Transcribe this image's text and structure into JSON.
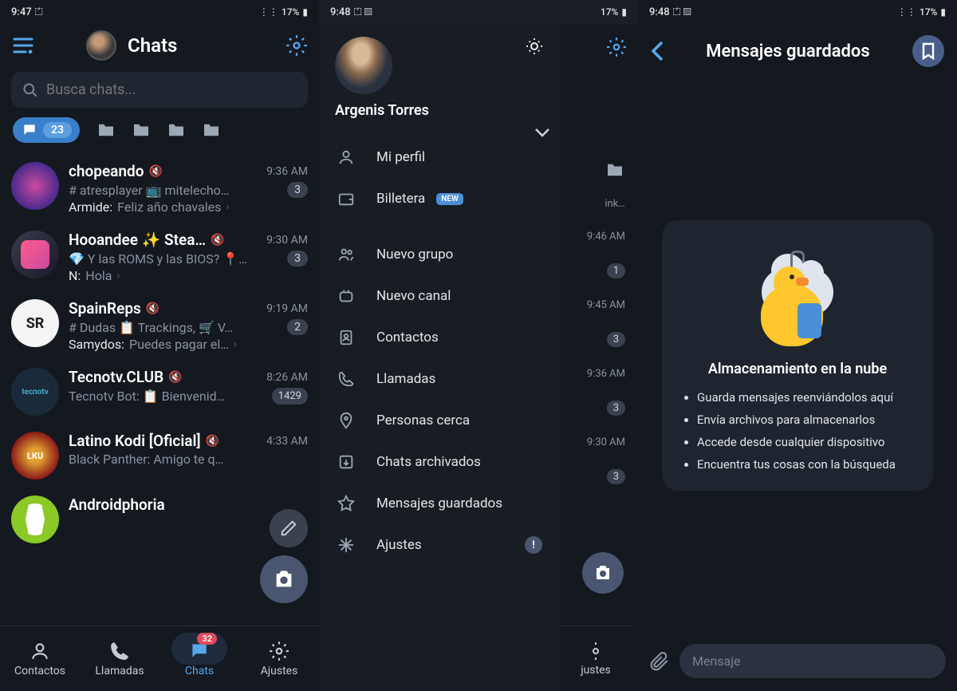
{
  "status": {
    "time1": "9:47",
    "time2": "9:48",
    "time3": "9:48",
    "battery": "17%"
  },
  "screen1": {
    "title": "Chats",
    "search_placeholder": "Busca chats...",
    "unread_pill": "23",
    "chats": [
      {
        "name": "chopeando",
        "time": "9:36 AM",
        "line1": "# atresplayer 📺 mitelecho…",
        "badge": "3",
        "sender": "Armide:",
        "msg": "Feliz año chavales"
      },
      {
        "name": "Hooandee ✨ Stea…",
        "time": "9:30 AM",
        "line1": "💎 Y las ROMS y las BIOS? 📍…",
        "badge": "3",
        "sender": "N:",
        "msg": "Hola"
      },
      {
        "name": "SpainReps",
        "time": "9:19 AM",
        "line1": "# Dudas 📋 Trackings, 🛒 V…",
        "badge": "2",
        "sender": "Samydos:",
        "msg": "Puedes pagar el…"
      },
      {
        "name": "Tecnotv.CLUB",
        "time": "8:26 AM",
        "line1": "Tecnotv Bot: 📋 Bienvenid…",
        "badge": "1429"
      },
      {
        "name": "Latino Kodi [Oficial]",
        "time": "4:33 AM",
        "line1": "Black Panther: Amigo te q…"
      },
      {
        "name": "Androidphoria",
        "time": ""
      }
    ],
    "nav": {
      "contactos": "Contactos",
      "llamadas": "Llamadas",
      "chats": "Chats",
      "ajustes": "Ajustes",
      "badge": "32"
    }
  },
  "screen2": {
    "name": "Argenis Torres",
    "items": {
      "perfil": "Mi perfil",
      "billetera": "Billetera",
      "new": "NEW",
      "grupo": "Nuevo grupo",
      "canal": "Nuevo canal",
      "contactos": "Contactos",
      "llamadas": "Llamadas",
      "cerca": "Personas cerca",
      "archivados": "Chats archivados",
      "guardados": "Mensajes guardados",
      "ajustes": "Ajustes"
    },
    "peek": {
      "t1": "ink…",
      "t2": "9:46 AM",
      "b2": "1",
      "t3": "9:45 AM",
      "b3": "3",
      "t4": "9:36 AM",
      "b4": "3",
      "t5": "9:30 AM",
      "b5": "3",
      "nav": "justes"
    }
  },
  "screen3": {
    "title": "Mensajes guardados",
    "card_title": "Almacenamiento en la nube",
    "bullets": [
      "Guarda mensajes reenviándolos aquí",
      "Envía archivos para almacenarlos",
      "Accede desde cualquier dispositivo",
      "Encuentra tus cosas con la búsqueda"
    ],
    "input_placeholder": "Mensaje"
  }
}
